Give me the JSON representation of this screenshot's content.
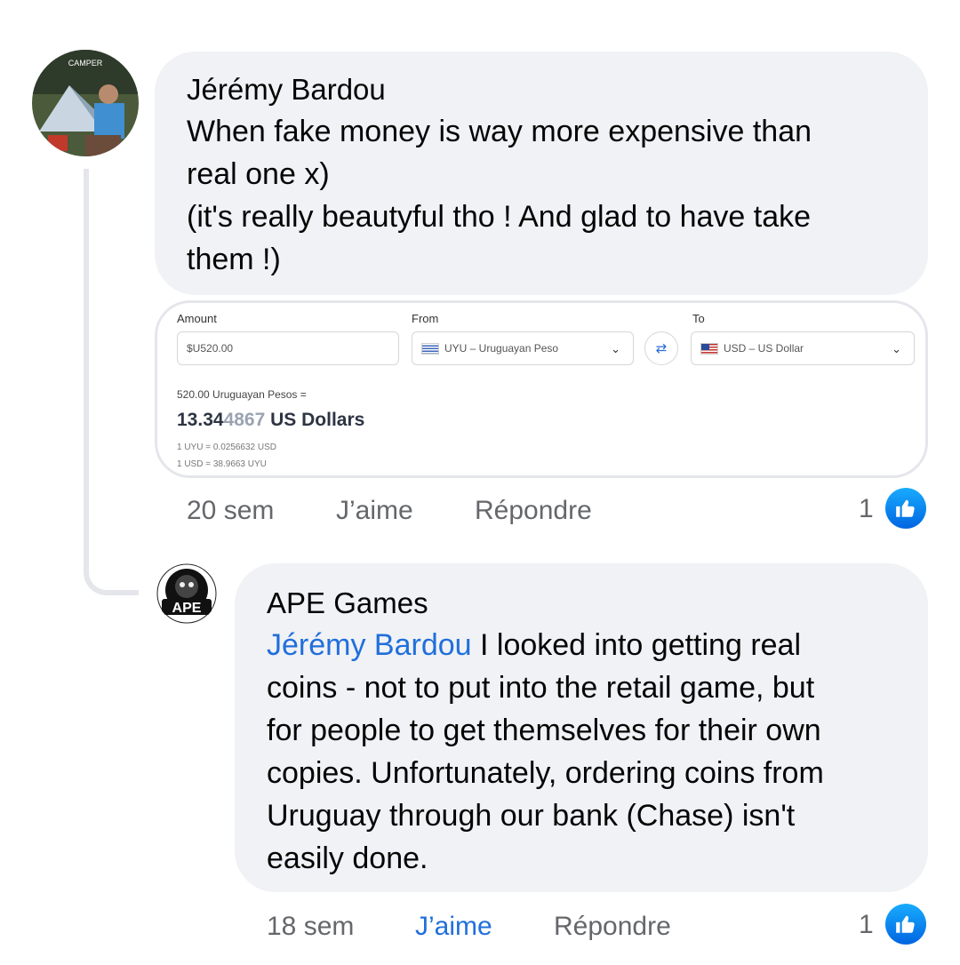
{
  "colors": {
    "bubble_bg": "#f0f2f5",
    "mention": "#216fdb",
    "meta": "#65676b",
    "like_blue": "#0866ff"
  },
  "comment1": {
    "author": "Jérémy Bardou",
    "avatar_badge": "CAMPER",
    "lines": [
      "When fake money is way more expensive than",
      "real one x)",
      "(it's really beautyful tho ! And glad to have take",
      "them !)"
    ],
    "attachment": {
      "amount_label": "Amount",
      "amount_value": "$U520.00",
      "from_label": "From",
      "from_value": "UYU – Uruguayan Peso",
      "to_label": "To",
      "to_value": "USD – US Dollar",
      "conversion_from": "520.00 Uruguayan Pesos =",
      "conversion_result_main": "13.34",
      "conversion_result_faded": "4867",
      "conversion_result_unit": " US Dollars",
      "rate1": "1 UYU = 0.0256632 USD",
      "rate2": "1 USD = 38.9663 UYU",
      "icons": [
        "uruguay-flag-icon",
        "us-flag-icon",
        "chevron-down-icon",
        "swap-icon"
      ]
    },
    "time": "20 sem",
    "like": "J’aime",
    "reply": "Répondre",
    "reaction_count": "1"
  },
  "comment2": {
    "author": "APE Games",
    "avatar_text": "APE",
    "mention": "Jérémy Bardou",
    "lines": [
      " I looked into getting real",
      "coins - not to put into the retail game, but",
      "for people to get themselves for their own",
      "copies. Unfortunately, ordering coins from",
      "Uruguay through our bank (Chase) isn't",
      "easily done."
    ],
    "time": "18 sem",
    "like": "J’aime",
    "like_active": true,
    "reply": "Répondre",
    "reaction_count": "1"
  }
}
